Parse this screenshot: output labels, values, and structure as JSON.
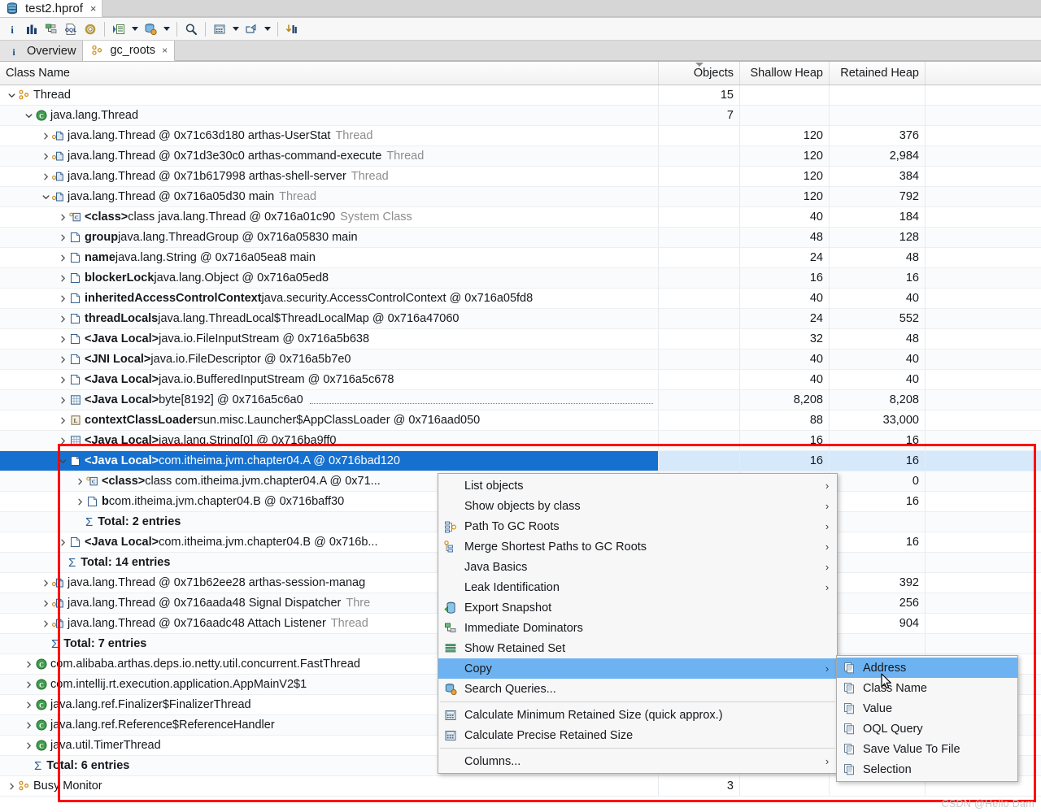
{
  "window": {
    "file_tab_label": "test2.hprof",
    "file_tab_close": "×",
    "file_icon": "heap-dump-icon"
  },
  "toolbar": {
    "buttons": [
      {
        "name": "overview-info-icon",
        "glyph": "i"
      },
      {
        "name": "histogram-icon",
        "glyph": "bars"
      },
      {
        "name": "dominator-tree-icon",
        "glyph": "tree"
      },
      {
        "name": "oql-icon",
        "glyph": "oql"
      },
      {
        "name": "settings-gear-icon",
        "glyph": "gear"
      },
      {
        "name": "run-expert-query-icon",
        "glyph": "run"
      },
      {
        "name": "query-browser-icon",
        "glyph": "query"
      },
      {
        "name": "search-icon",
        "glyph": "search"
      },
      {
        "name": "calculator-icon",
        "glyph": "calc"
      },
      {
        "name": "export-icon",
        "glyph": "export"
      },
      {
        "name": "compare-icon",
        "glyph": "compare"
      }
    ]
  },
  "view_tabs": [
    {
      "label": "Overview",
      "icon": "info-icon",
      "active": false,
      "closable": false
    },
    {
      "label": "gc_roots",
      "icon": "gc-roots-icon",
      "active": true,
      "closable": true,
      "close": "×"
    }
  ],
  "table": {
    "columns": [
      {
        "label": "Class Name",
        "align": "left",
        "sorted": false
      },
      {
        "label": "Objects",
        "align": "right",
        "sorted": true
      },
      {
        "label": "Shallow Heap",
        "align": "right",
        "sorted": false
      },
      {
        "label": "Retained Heap",
        "align": "right",
        "sorted": false
      },
      {
        "label": "",
        "align": "right",
        "sorted": false
      }
    ],
    "rows": [
      {
        "indent": 0,
        "twisty": "down",
        "icon": "gc-roots-icon",
        "name": "Thread",
        "bold": false,
        "type": "",
        "objects": "15",
        "shallow": "",
        "retained": ""
      },
      {
        "indent": 1,
        "twisty": "down",
        "icon": "class-icon",
        "name": "java.lang.Thread",
        "bold": false,
        "type": "",
        "objects": "7",
        "shallow": "",
        "retained": ""
      },
      {
        "indent": 2,
        "twisty": "right",
        "icon": "thread-obj-icon",
        "name": "java.lang.Thread @ 0x71c63d180  arthas-UserStat",
        "bold": false,
        "type": "Thread",
        "objects": "",
        "shallow": "120",
        "retained": "376"
      },
      {
        "indent": 2,
        "twisty": "right",
        "icon": "thread-obj-icon",
        "name": "java.lang.Thread @ 0x71d3e30c0  arthas-command-execute",
        "bold": false,
        "type": "Thread",
        "objects": "",
        "shallow": "120",
        "retained": "2,984"
      },
      {
        "indent": 2,
        "twisty": "right",
        "icon": "thread-obj-icon",
        "name": "java.lang.Thread @ 0x71b617998  arthas-shell-server",
        "bold": false,
        "type": "Thread",
        "objects": "",
        "shallow": "120",
        "retained": "384"
      },
      {
        "indent": 2,
        "twisty": "down",
        "icon": "thread-obj-icon",
        "name": "java.lang.Thread @ 0x716a05d30  main",
        "bold": false,
        "type": "Thread",
        "objects": "",
        "shallow": "120",
        "retained": "792"
      },
      {
        "indent": 3,
        "twisty": "right",
        "icon": "class-ref-icon",
        "name": "<class> class java.lang.Thread @ 0x716a01c90",
        "bold_prefix": "<class>",
        "type": "System Class",
        "objects": "",
        "shallow": "40",
        "retained": "184"
      },
      {
        "indent": 3,
        "twisty": "right",
        "icon": "field-icon",
        "name": "group java.lang.ThreadGroup @ 0x716a05830  main",
        "bold_prefix": "group",
        "type": "",
        "objects": "",
        "shallow": "48",
        "retained": "128"
      },
      {
        "indent": 3,
        "twisty": "right",
        "icon": "field-icon",
        "name": "name java.lang.String @ 0x716a05ea8  main",
        "bold_prefix": "name",
        "type": "",
        "objects": "",
        "shallow": "24",
        "retained": "48"
      },
      {
        "indent": 3,
        "twisty": "right",
        "icon": "field-icon",
        "name": "blockerLock java.lang.Object @ 0x716a05ed8",
        "bold_prefix": "blockerLock",
        "type": "",
        "objects": "",
        "shallow": "16",
        "retained": "16"
      },
      {
        "indent": 3,
        "twisty": "right",
        "icon": "field-icon",
        "name": "inheritedAccessControlContext java.security.AccessControlContext @ 0x716a05fd8",
        "bold_prefix": "inheritedAccessControlContext",
        "type": "",
        "objects": "",
        "shallow": "40",
        "retained": "40"
      },
      {
        "indent": 3,
        "twisty": "right",
        "icon": "field-icon",
        "name": "threadLocals java.lang.ThreadLocal$ThreadLocalMap @ 0x716a47060",
        "bold_prefix": "threadLocals",
        "type": "",
        "objects": "",
        "shallow": "24",
        "retained": "552"
      },
      {
        "indent": 3,
        "twisty": "right",
        "icon": "field-icon",
        "name": "<Java Local> java.io.FileInputStream @ 0x716a5b638",
        "bold_prefix": "<Java Local>",
        "type": "",
        "objects": "",
        "shallow": "32",
        "retained": "48"
      },
      {
        "indent": 3,
        "twisty": "right",
        "icon": "field-icon",
        "name": "<JNI Local> java.io.FileDescriptor @ 0x716a5b7e0",
        "bold_prefix": "<JNI Local>",
        "type": "",
        "objects": "",
        "shallow": "40",
        "retained": "40"
      },
      {
        "indent": 3,
        "twisty": "right",
        "icon": "field-icon",
        "name": "<Java Local> java.io.BufferedInputStream @ 0x716a5c678",
        "bold_prefix": "<Java Local>",
        "type": "",
        "objects": "",
        "shallow": "40",
        "retained": "40"
      },
      {
        "indent": 3,
        "twisty": "right",
        "icon": "array-icon",
        "name": "<Java Local> byte[8192] @ 0x716a5c6a0",
        "bold_prefix": "<Java Local>",
        "type": "",
        "dots": true,
        "objects": "",
        "shallow": "8,208",
        "retained": "8,208"
      },
      {
        "indent": 3,
        "twisty": "right",
        "icon": "classloader-icon",
        "name": "contextClassLoader sun.misc.Launcher$AppClassLoader @ 0x716aad050",
        "bold_prefix": "contextClassLoader",
        "type": "",
        "objects": "",
        "shallow": "88",
        "retained": "33,000"
      },
      {
        "indent": 3,
        "twisty": "right",
        "icon": "array-icon",
        "name": "<Java Local> java.lang.String[0] @ 0x716ba9ff0",
        "bold_prefix": "<Java Local>",
        "type": "",
        "objects": "",
        "shallow": "16",
        "retained": "16"
      },
      {
        "indent": 3,
        "twisty": "down",
        "icon": "object-icon",
        "name": "<Java Local> com.itheima.jvm.chapter04.A @ 0x716bad120",
        "bold_prefix": "<Java Local>",
        "type": "",
        "selected": true,
        "objects": "",
        "shallow": "16",
        "retained": "16"
      },
      {
        "indent": 4,
        "twisty": "right",
        "icon": "class-ref-icon",
        "name": "<class> class com.itheima.jvm.chapter04.A @ 0x71...",
        "bold_prefix": "<class>",
        "type": "",
        "objects": "",
        "shallow": "",
        "retained": "0"
      },
      {
        "indent": 4,
        "twisty": "right",
        "icon": "field-icon",
        "name": "b com.itheima.jvm.chapter04.B @ 0x716baff30",
        "bold_prefix": "b",
        "type": "",
        "objects": "",
        "shallow": "",
        "retained": "16"
      },
      {
        "indent": 4,
        "twisty": "none",
        "icon": "sigma-icon",
        "name": "Total: 2 entries",
        "bold": true,
        "type": "",
        "objects": "",
        "shallow": "",
        "retained": ""
      },
      {
        "indent": 3,
        "twisty": "right",
        "icon": "field-icon",
        "name": "<Java Local> com.itheima.jvm.chapter04.B @ 0x716b...",
        "bold_prefix": "<Java Local>",
        "type": "",
        "objects": "",
        "shallow": "",
        "retained": "16"
      },
      {
        "indent": 3,
        "twisty": "none",
        "icon": "sigma-icon",
        "name": "Total: 14 entries",
        "bold": true,
        "type": "",
        "objects": "",
        "shallow": "",
        "retained": ""
      },
      {
        "indent": 2,
        "twisty": "right",
        "icon": "thread-obj-icon",
        "name": "java.lang.Thread @ 0x71b62ee28  arthas-session-manag",
        "bold": false,
        "type": "",
        "objects": "",
        "shallow": "",
        "retained": "392"
      },
      {
        "indent": 2,
        "twisty": "right",
        "icon": "thread-obj-icon",
        "name": "java.lang.Thread @ 0x716aada48  Signal Dispatcher",
        "bold": false,
        "type": "Thre",
        "objects": "",
        "shallow": "",
        "retained": "256"
      },
      {
        "indent": 2,
        "twisty": "right",
        "icon": "thread-obj-icon",
        "name": "java.lang.Thread @ 0x716aadc48  Attach Listener",
        "bold": false,
        "type": "Thread",
        "objects": "",
        "shallow": "",
        "retained": "904"
      },
      {
        "indent": 2,
        "twisty": "none",
        "icon": "sigma-icon",
        "name": "Total: 7 entries",
        "bold": true,
        "type": "",
        "objects": "",
        "shallow": "",
        "retained": ""
      },
      {
        "indent": 1,
        "twisty": "right",
        "icon": "class-icon",
        "name": "com.alibaba.arthas.deps.io.netty.util.concurrent.FastThread",
        "bold": false,
        "type": "",
        "objects": "",
        "shallow": "",
        "retained": ""
      },
      {
        "indent": 1,
        "twisty": "right",
        "icon": "class-icon",
        "name": "com.intellij.rt.execution.application.AppMainV2$1",
        "bold": false,
        "type": "",
        "objects": "",
        "shallow": "",
        "retained": ""
      },
      {
        "indent": 1,
        "twisty": "right",
        "icon": "class-icon",
        "name": "java.lang.ref.Finalizer$FinalizerThread",
        "bold": false,
        "type": "",
        "objects": "",
        "shallow": "",
        "retained": ""
      },
      {
        "indent": 1,
        "twisty": "right",
        "icon": "class-icon",
        "name": "java.lang.ref.Reference$ReferenceHandler",
        "bold": false,
        "type": "",
        "objects": "",
        "shallow": "",
        "retained": ""
      },
      {
        "indent": 1,
        "twisty": "right",
        "icon": "class-icon",
        "name": "java.util.TimerThread",
        "bold": false,
        "type": "",
        "objects": "",
        "shallow": "",
        "retained": ""
      },
      {
        "indent": 1,
        "twisty": "none",
        "icon": "sigma-icon",
        "name": "Total: 6 entries",
        "bold": true,
        "type": "",
        "objects": "",
        "shallow": "",
        "retained": ""
      },
      {
        "indent": 0,
        "twisty": "right",
        "icon": "gc-roots-icon",
        "name": "Busy Monitor",
        "bold": false,
        "type": "",
        "objects": "3",
        "shallow": "",
        "retained": ""
      }
    ]
  },
  "context_menu": {
    "items": [
      {
        "label": "List objects",
        "icon": "",
        "submenu": true,
        "highlighted": false
      },
      {
        "label": "Show objects by class",
        "icon": "",
        "submenu": true,
        "highlighted": false
      },
      {
        "label": "Path To GC Roots",
        "icon": "path-gc-roots-icon",
        "submenu": true,
        "highlighted": false
      },
      {
        "label": "Merge Shortest Paths to GC Roots",
        "icon": "merge-paths-icon",
        "submenu": true,
        "highlighted": false
      },
      {
        "label": "Java Basics",
        "icon": "",
        "submenu": true,
        "highlighted": false
      },
      {
        "label": "Leak Identification",
        "icon": "",
        "submenu": true,
        "highlighted": false
      },
      {
        "label": "Export Snapshot",
        "icon": "export-snapshot-icon",
        "submenu": false,
        "highlighted": false
      },
      {
        "label": "Immediate Dominators",
        "icon": "dominators-icon",
        "submenu": false,
        "highlighted": false
      },
      {
        "label": "Show Retained Set",
        "icon": "retained-set-icon",
        "submenu": false,
        "highlighted": false
      },
      {
        "label": "Copy",
        "icon": "",
        "submenu": true,
        "highlighted": true
      },
      {
        "label": "Search Queries...",
        "icon": "search-queries-icon",
        "submenu": false,
        "highlighted": false
      },
      {
        "separator": true
      },
      {
        "label": "Calculate Minimum Retained Size (quick approx.)",
        "icon": "calculator-icon",
        "submenu": false,
        "highlighted": false
      },
      {
        "label": "Calculate Precise Retained Size",
        "icon": "calculator-icon",
        "submenu": false,
        "highlighted": false
      },
      {
        "separator": true
      },
      {
        "label": "Columns...",
        "icon": "",
        "submenu": true,
        "highlighted": false
      }
    ]
  },
  "copy_submenu": {
    "items": [
      {
        "label": "Address",
        "icon": "copy-icon",
        "highlighted": true
      },
      {
        "label": "Class Name",
        "icon": "copy-icon",
        "highlighted": false
      },
      {
        "label": "Value",
        "icon": "copy-icon",
        "highlighted": false
      },
      {
        "label": "OQL Query",
        "icon": "copy-icon",
        "highlighted": false
      },
      {
        "label": "Save Value To File",
        "icon": "copy-icon",
        "highlighted": false
      },
      {
        "label": "Selection",
        "icon": "copy-icon",
        "highlighted": false
      }
    ]
  },
  "annotation": {
    "highlight_color": "#ff0000",
    "watermark": "CSDN @Hello Dam"
  }
}
